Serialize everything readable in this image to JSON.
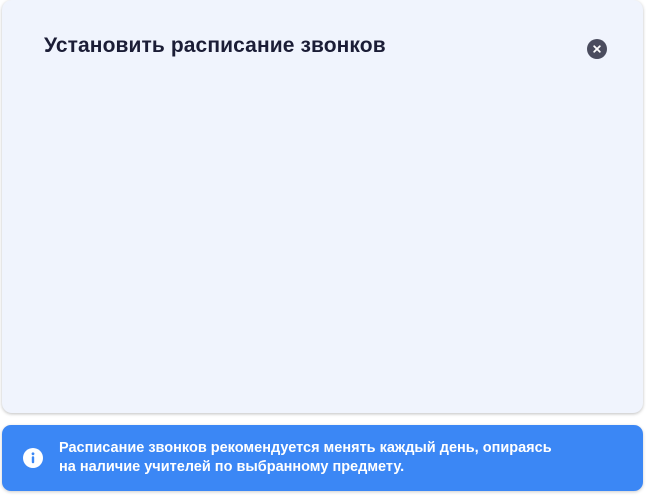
{
  "modal": {
    "title": "Установить расписание звонков",
    "close_icon": "close-icon"
  },
  "info_banner": {
    "icon": "info-icon",
    "line1": "Расписание звонков рекомендуется менять каждый день, опираясь",
    "line2": "на наличие учителей по выбранному предмету."
  },
  "colors": {
    "modal_bg": "#f0f4fd",
    "title": "#1b1d36",
    "close_button": "#4a4c5e",
    "banner_bg": "#3b87f5",
    "banner_text": "#ffffff"
  }
}
